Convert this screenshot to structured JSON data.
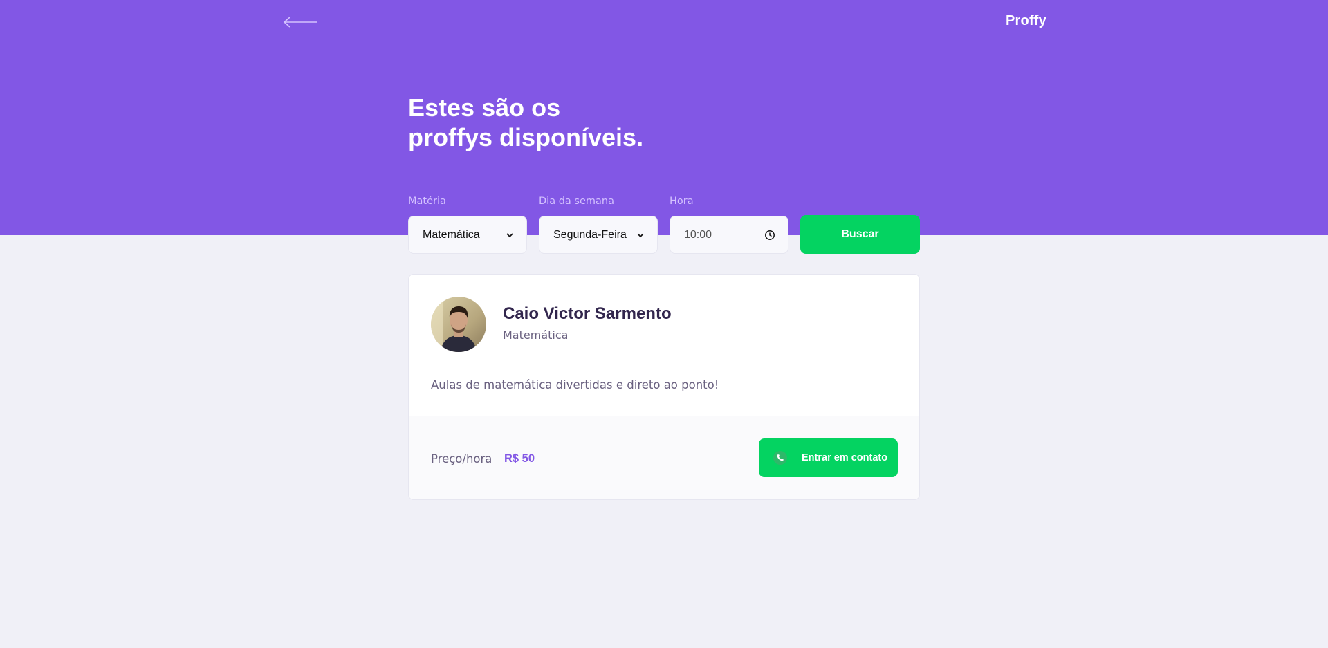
{
  "header": {
    "back_icon": "arrow-left-icon",
    "logo": "Proffy",
    "title_line1": "Estes são os",
    "title_line2": "proffys disponíveis."
  },
  "filters": {
    "subject": {
      "label": "Matéria",
      "value": "Matemática"
    },
    "week_day": {
      "label": "Dia da semana",
      "value": "Segunda-Feira"
    },
    "time": {
      "label": "Hora",
      "value": "10:00"
    },
    "search_label": "Buscar"
  },
  "teacher": {
    "name": "Caio Victor Sarmento",
    "subject": "Matemática",
    "bio": "Aulas de matemática divertidas e direto ao ponto!",
    "price_label": "Preço/hora",
    "price_value": "R$ 50",
    "contact_label": "Entrar em contato",
    "contact_icon": "whatsapp-icon"
  },
  "colors": {
    "primary": "#8257e5",
    "secondary": "#04d361",
    "background": "#f0f0f7",
    "title_text": "#32264d",
    "body_text": "#6a6180"
  }
}
